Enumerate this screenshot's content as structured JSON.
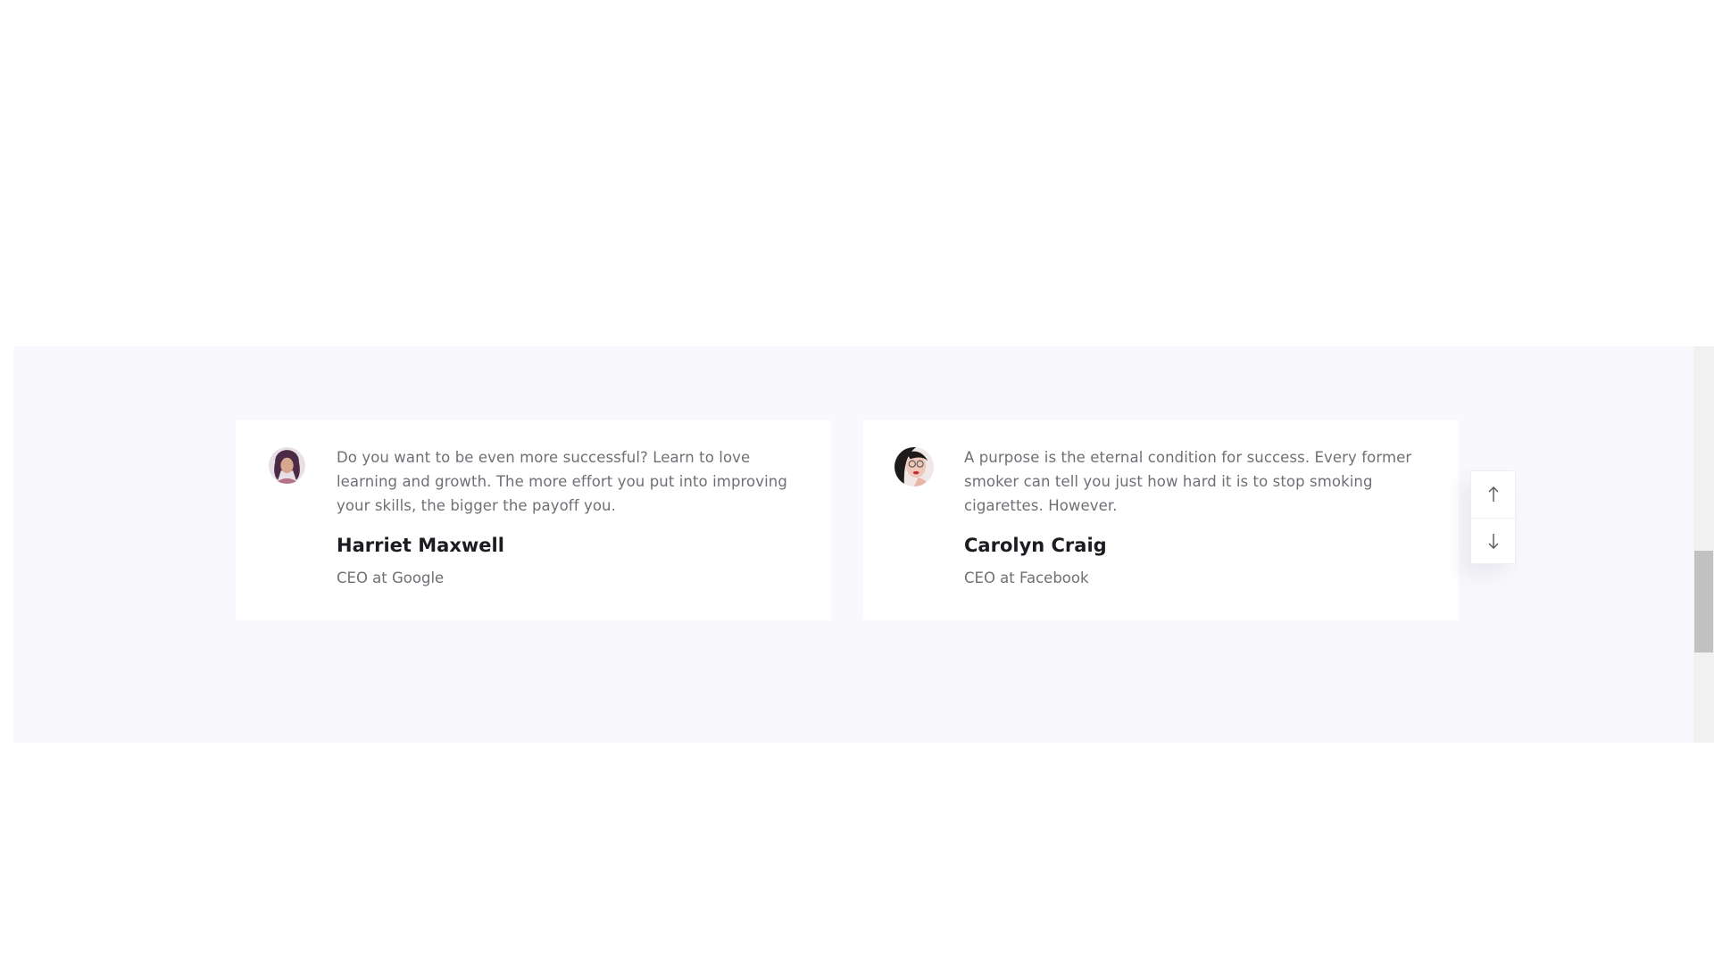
{
  "testimonials": [
    {
      "quote": "Do you want to be even more successful? Learn to love learning and growth. The more effort you put into improving your skills, the bigger the payoff you.",
      "name": "Harriet Maxwell",
      "role": "CEO at Google",
      "avatar_icon": "avatar-woman-dark-hair"
    },
    {
      "quote": "A purpose is the eternal condition for success. Every former smoker can tell you just how hard it is to stop smoking cigarettes. However.",
      "name": "Carolyn Craig",
      "role": "CEO at Facebook",
      "avatar_icon": "avatar-woman-glasses"
    }
  ],
  "slider_nav": {
    "up_icon": "arrow-up-icon",
    "down_icon": "arrow-down-icon"
  },
  "colors": {
    "section_bg": "#f9f9fd",
    "card_bg": "#ffffff",
    "heading": "#1b1b22",
    "body_text": "#6f6f76"
  }
}
